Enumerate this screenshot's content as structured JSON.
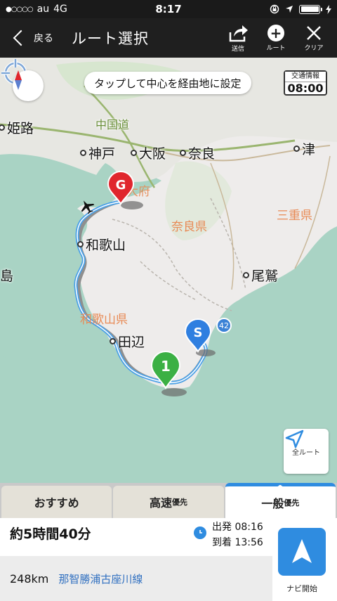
{
  "status_bar": {
    "signal": "●○○○○",
    "carrier": "au",
    "network": "4G",
    "time": "8:17",
    "battery_level": 1.0
  },
  "nav": {
    "back_label": "戻る",
    "title": "ルート選択",
    "actions": [
      {
        "name": "send",
        "label": "送信",
        "icon": "share-icon"
      },
      {
        "name": "via-point",
        "label": "ルート",
        "icon": "plus-circle-icon"
      },
      {
        "name": "clear",
        "label": "クリア",
        "icon": "close-icon"
      }
    ]
  },
  "map": {
    "hint": "タップして中心を経由地に設定",
    "traffic_info_label": "交通情報",
    "traffic_time": "08:00",
    "all_route_label": "全ルート",
    "highway_badge": "42",
    "cities": [
      {
        "name": "姫路"
      },
      {
        "name": "神戸"
      },
      {
        "name": "大阪"
      },
      {
        "name": "奈良"
      },
      {
        "name": "津"
      },
      {
        "name": "和歌山"
      },
      {
        "name": "尾鷲"
      },
      {
        "name": "田辺"
      }
    ],
    "prefectures": [
      {
        "name": "奈良県"
      },
      {
        "name": "三重県"
      },
      {
        "name": "和歌山県"
      }
    ],
    "partial_labels": [
      {
        "name": "島"
      },
      {
        "name": "中国道"
      },
      {
        "name": "大府"
      }
    ],
    "markers": {
      "goal": "G",
      "start": "S",
      "waypoint": "1"
    },
    "colors": {
      "route": "#4aa0e6",
      "goal": "#e0262d",
      "start": "#2f7fe0",
      "waypoint": "#3bb044"
    }
  },
  "tabs": [
    {
      "label": "おすすめ",
      "sub": ""
    },
    {
      "label": "高速",
      "sub": "優先"
    },
    {
      "label": "一般",
      "sub": "優先",
      "active": true
    }
  ],
  "summary": {
    "duration": "約5時間40分",
    "depart_label": "出発",
    "depart_time": "08:16",
    "arrive_label": "到着",
    "arrive_time": "13:56",
    "distance": "248km",
    "road": "那智勝浦古座川線",
    "start_label": "ナビ開始"
  },
  "accent": "#2f8ce0"
}
